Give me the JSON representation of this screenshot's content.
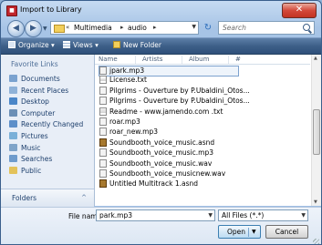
{
  "window": {
    "title": "Import to Library",
    "close_glyph": "✕"
  },
  "nav": {
    "back_glyph": "◀",
    "forward_glyph": "▶",
    "path": [
      "Multimedia",
      "audio"
    ],
    "search_placeholder": "Search",
    "refresh_glyph": "↻"
  },
  "toolbar": {
    "organize": "Organize",
    "views": "Views",
    "new_folder": "New Folder"
  },
  "sidebar": {
    "title": "Favorite Links",
    "items": [
      {
        "label": "Documents",
        "icon": "documents-icon",
        "color": "#7aa2cf"
      },
      {
        "label": "Recent Places",
        "icon": "recent-places-icon",
        "color": "#8fb2d8"
      },
      {
        "label": "Desktop",
        "icon": "desktop-icon",
        "color": "#4a86c8"
      },
      {
        "label": "Computer",
        "icon": "computer-icon",
        "color": "#6b8fb6"
      },
      {
        "label": "Recently Changed",
        "icon": "recently-changed-icon",
        "color": "#5d8fc9"
      },
      {
        "label": "Pictures",
        "icon": "pictures-icon",
        "color": "#7ab0d8"
      },
      {
        "label": "Music",
        "icon": "music-icon",
        "color": "#7fa4c9"
      },
      {
        "label": "Searches",
        "icon": "searches-icon",
        "color": "#6e9bcc"
      },
      {
        "label": "Public",
        "icon": "public-folder-icon",
        "color": "#e3c25a"
      }
    ],
    "folders_label": "Folders",
    "folders_chevron": "^"
  },
  "columns": [
    "Name",
    "Artists",
    "Album",
    "#"
  ],
  "files": [
    {
      "name": "jpark.mp3",
      "type": "mp3",
      "selected": true
    },
    {
      "name": "License.txt",
      "type": "txt"
    },
    {
      "name": "Pilgrims - Ouverture by P.Ubaldini_Otos...",
      "type": "mp3"
    },
    {
      "name": "Pilgrims - Ouverture by P.Ubaldini_Otos...",
      "type": "mp3"
    },
    {
      "name": "Readme - www.jamendo.com .txt",
      "type": "txt"
    },
    {
      "name": "roar.mp3",
      "type": "mp3"
    },
    {
      "name": "roar_new.mp3",
      "type": "mp3"
    },
    {
      "name": "Soundbooth_voice_music.asnd",
      "type": "asnd"
    },
    {
      "name": "Soundbooth_voice_music.mp3",
      "type": "mp3"
    },
    {
      "name": "Soundbooth_voice_music.wav",
      "type": "mp3"
    },
    {
      "name": "Soundbooth_voice_musicnew.wav",
      "type": "mp3"
    },
    {
      "name": "Untitled Multitrack 1.asnd",
      "type": "asnd"
    }
  ],
  "bottom": {
    "file_name_label": "File name:",
    "file_name_value": "park.mp3",
    "file_type_value": "All Files (*.*)",
    "open_label": "Open",
    "cancel_label": "Cancel"
  }
}
